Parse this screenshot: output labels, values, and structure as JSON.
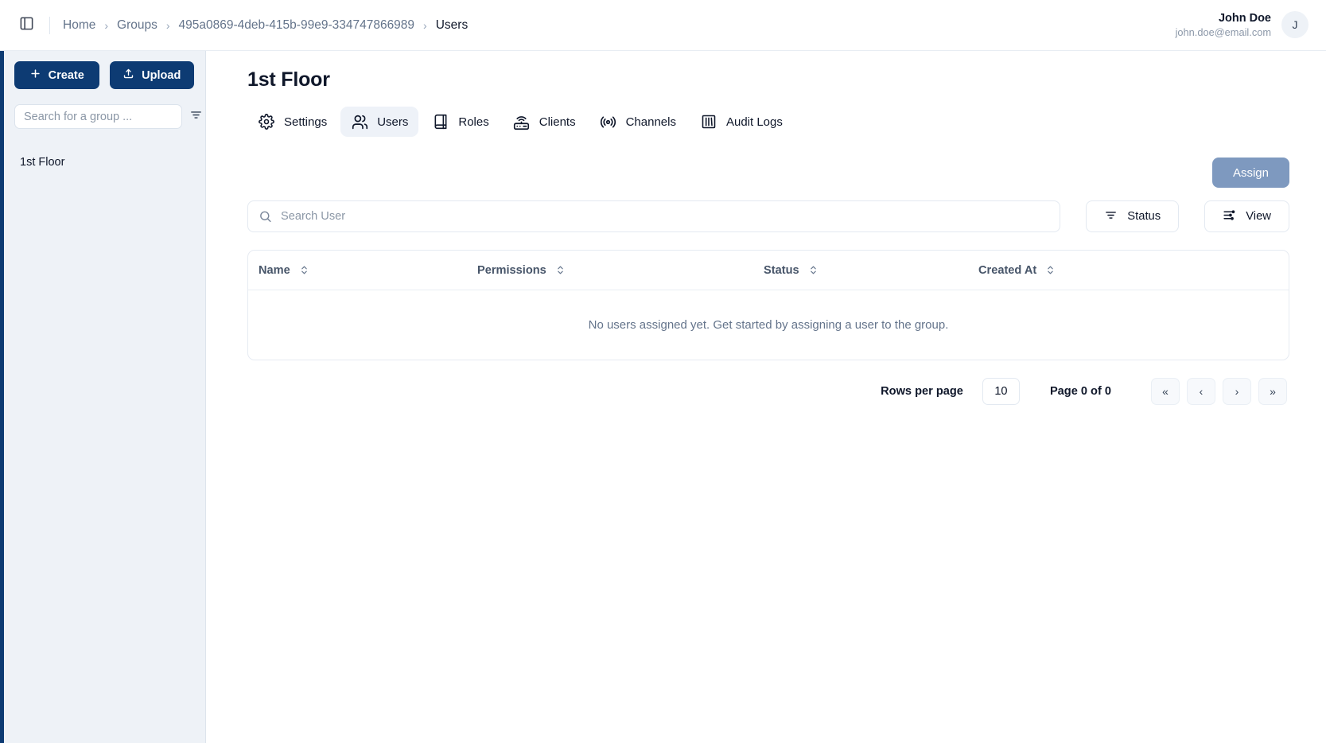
{
  "topbar": {
    "panel_toggle_icon": "panel-left-icon",
    "breadcrumb": [
      {
        "label": "Home",
        "current": false
      },
      {
        "label": "Groups",
        "current": false
      },
      {
        "label": "495a0869-4deb-415b-99e9-334747866989",
        "current": false
      },
      {
        "label": "Users",
        "current": true
      }
    ],
    "separator": "›",
    "user": {
      "name": "John Doe",
      "email": "john.doe@email.com",
      "avatar_initial": "J"
    }
  },
  "sidebar": {
    "create_label": "Create",
    "create_icon": "plus-icon",
    "upload_label": "Upload",
    "upload_icon": "upload-icon",
    "search_placeholder": "Search for a group ...",
    "search_value": "",
    "filter_icon": "filter-icon",
    "groups": [
      {
        "label": "1st Floor"
      }
    ]
  },
  "main": {
    "title": "1st Floor",
    "tabs": [
      {
        "label": "Settings",
        "icon": "gear-icon",
        "active": false
      },
      {
        "label": "Users",
        "icon": "users-icon",
        "active": true
      },
      {
        "label": "Roles",
        "icon": "book-icon",
        "active": false
      },
      {
        "label": "Clients",
        "icon": "router-icon",
        "active": false
      },
      {
        "label": "Channels",
        "icon": "radio-icon",
        "active": false
      },
      {
        "label": "Audit Logs",
        "icon": "library-icon",
        "active": false
      }
    ],
    "assign_label": "Assign",
    "assign_disabled": true,
    "search_placeholder": "Search User",
    "search_value": "",
    "search_icon": "search-icon",
    "status_label": "Status",
    "status_icon": "filter-icon",
    "view_label": "View",
    "view_icon": "sliders-icon",
    "table": {
      "columns": [
        {
          "label": "Name",
          "sort_icon": "sort-icon"
        },
        {
          "label": "Permissions",
          "sort_icon": "sort-icon"
        },
        {
          "label": "Status",
          "sort_icon": "sort-icon"
        },
        {
          "label": "Created At",
          "sort_icon": "sort-icon"
        }
      ],
      "rows": [],
      "empty_message": "No users assigned yet. Get started by assigning a user to the group."
    },
    "pagination": {
      "rows_per_page_label": "Rows per page",
      "rows_per_page_value": "10",
      "page_label": "Page 0 of 0",
      "first_icon": "«",
      "prev_icon": "‹",
      "next_icon": "›",
      "last_icon": "»"
    }
  },
  "colors": {
    "brand_navy": "#0d3b73",
    "sidebar_bg": "#eef2f7",
    "assign_disabled": "#7e99bf",
    "text_primary": "#0f172a",
    "text_muted": "#64748b"
  }
}
